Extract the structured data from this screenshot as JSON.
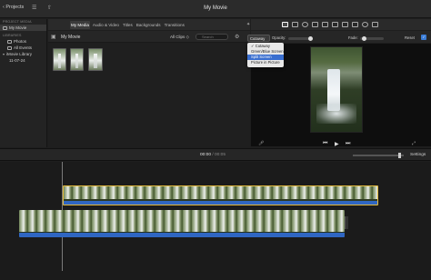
{
  "topbar": {
    "projects_label": "‹ Projects",
    "title": "My Movie"
  },
  "sidebar": {
    "project_media_header": "PROJECT MEDIA",
    "project_item": "My Movie",
    "libraries_header": "LIBRARIES",
    "items": [
      {
        "label": "Photos",
        "icon": "photos-icon"
      },
      {
        "label": "All Events",
        "icon": "events-icon"
      },
      {
        "label": "iMovie Library",
        "icon": "library-icon"
      },
      {
        "label": "11-07-24",
        "icon": "event-icon"
      }
    ]
  },
  "media": {
    "tabs": [
      "My Media",
      "Audio & Video",
      "Titles",
      "Backgrounds",
      "Transitions"
    ],
    "active_tab": "My Media",
    "browser_label": "My Movie",
    "filter": "All Clips ◇",
    "search_placeholder": "Search",
    "thumbnail_count": 3
  },
  "viewer": {
    "overlay_dropdown": "Cutaway",
    "opacity_label": "Opacity:",
    "fade_label": "Fade:",
    "reset_label": "Reset",
    "menu_items": [
      "Cutaway",
      "Green/Blue Screen",
      "Split Screen",
      "Picture in Picture"
    ],
    "menu_checked": "Cutaway",
    "menu_highlighted": "Split Screen"
  },
  "timeline": {
    "current_time": "00:00",
    "separator": " / ",
    "total_time": "00:05",
    "settings_label": "Settings"
  },
  "colors": {
    "selection_border": "#e2b93d",
    "audio_bar": "#2f66c2",
    "menu_highlight": "#3a6fd0"
  }
}
